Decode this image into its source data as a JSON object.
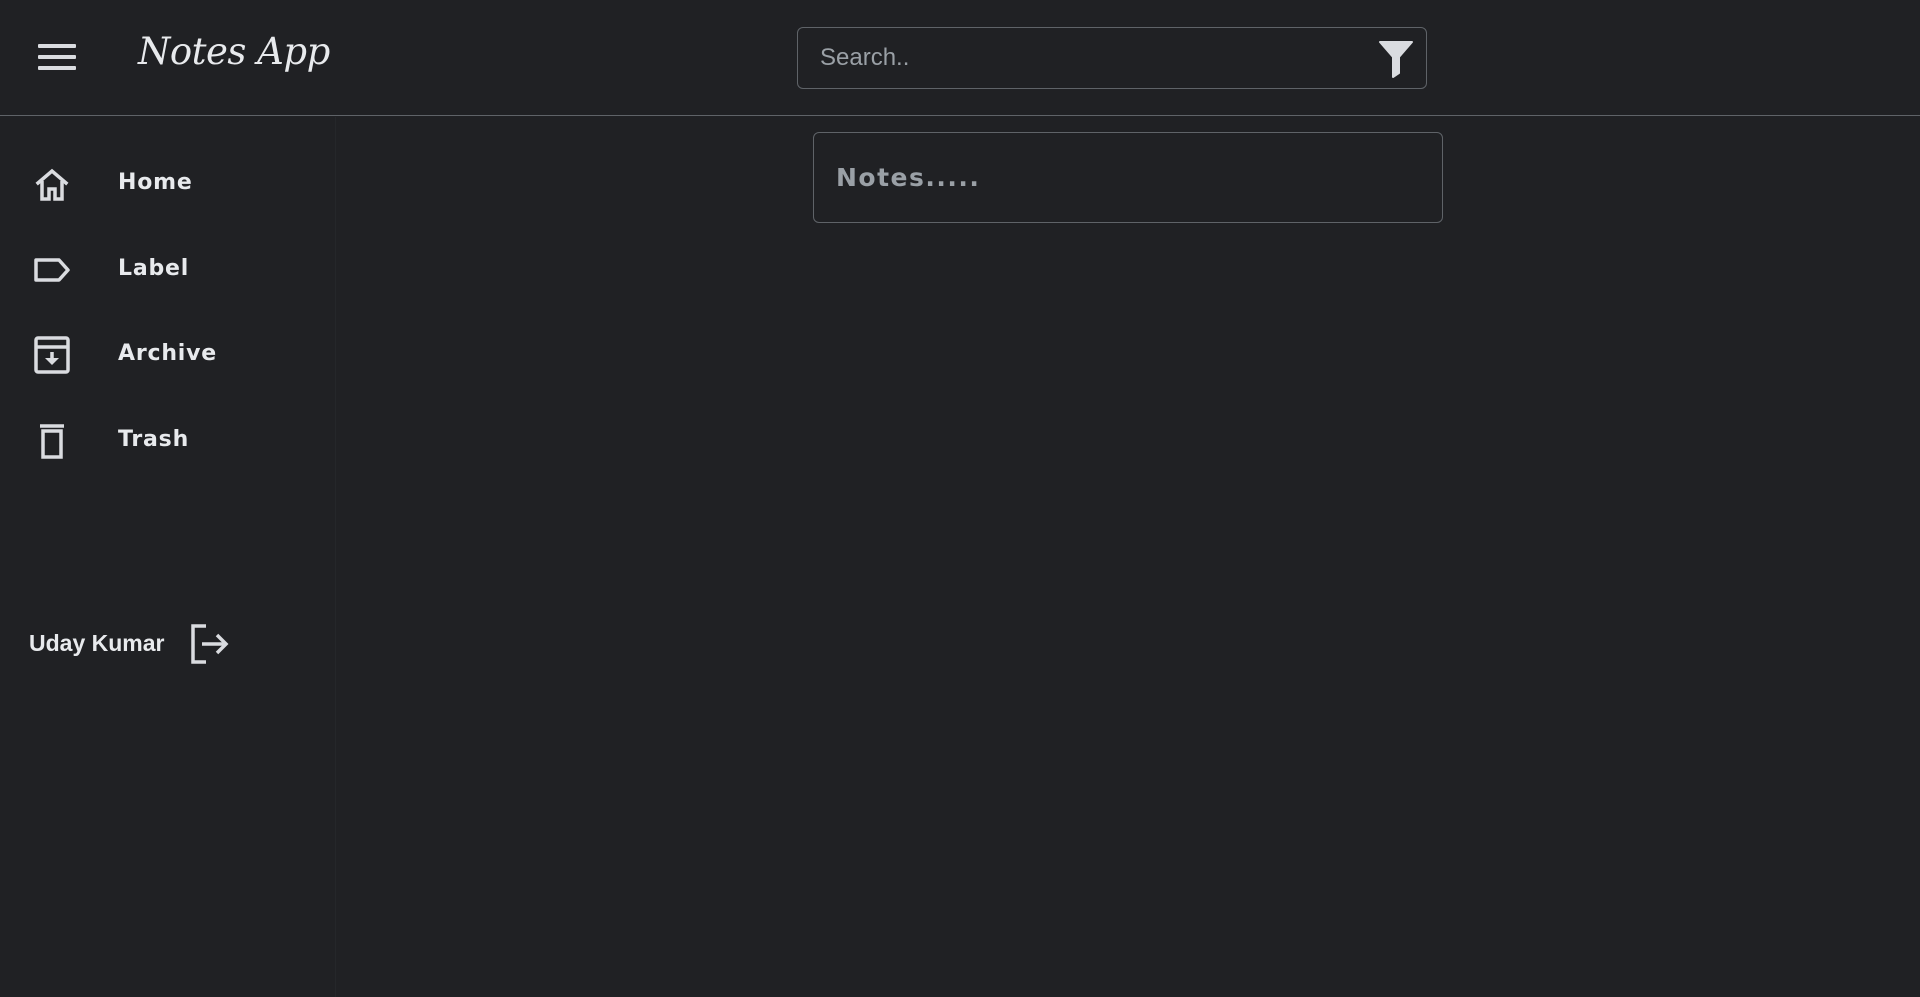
{
  "app": {
    "title": "Notes App"
  },
  "header": {
    "menu_icon": "hamburger-menu-icon",
    "search": {
      "placeholder": "Search..",
      "value": ""
    },
    "filter_icon": "filter-funnel-icon"
  },
  "sidebar": {
    "items": [
      {
        "label": "Home",
        "icon": "home-icon"
      },
      {
        "label": "Label",
        "icon": "label-tag-icon"
      },
      {
        "label": "Archive",
        "icon": "archive-icon"
      },
      {
        "label": "Trash",
        "icon": "trash-icon"
      }
    ]
  },
  "user": {
    "name": "Uday Kumar",
    "logout_icon": "logout-icon"
  },
  "main": {
    "note_input": {
      "placeholder": "Notes.....",
      "value": ""
    }
  },
  "colors": {
    "background": "#202124",
    "text": "#e8eaed",
    "border": "#5f6368",
    "placeholder": "#9aa0a6",
    "icon": "#dadce0"
  }
}
